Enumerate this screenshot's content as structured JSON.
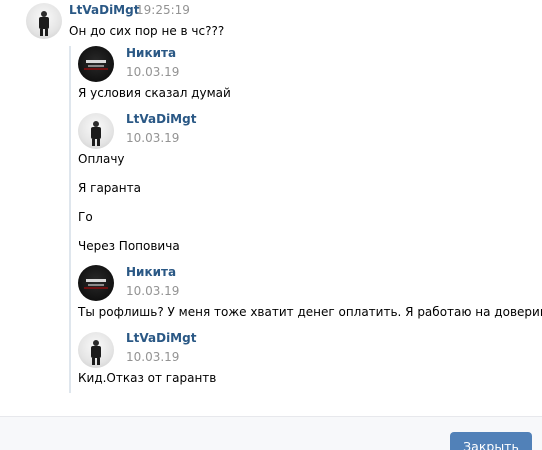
{
  "main_message": {
    "author": "LtVaDiMgt",
    "time": "19:25:19",
    "text": "Он до сих пор не в чс???"
  },
  "forwarded": [
    {
      "author": "Никита",
      "date": "10.03.19",
      "lines": [
        "Я условия сказал думай"
      ]
    },
    {
      "author": "LtVaDiMgt",
      "date": "10.03.19",
      "lines": [
        "Оплачу",
        "Я гаранта",
        "Го",
        "Через Поповича"
      ]
    },
    {
      "author": "Никита",
      "date": "10.03.19",
      "lines": [
        "Ты рофлишь? У меня тоже хватит денег оплатить. Я работаю на доверии."
      ]
    },
    {
      "author": "LtVaDiMgt",
      "date": "10.03.19",
      "lines": [
        "Кид.Отказ от гарантв"
      ]
    }
  ],
  "footer": {
    "close_label": "Закрыть"
  },
  "icons": {
    "avatar_light": "user-avatar-icon",
    "avatar_dark": "user-avatar-icon"
  },
  "colors": {
    "author_link": "#2a5885",
    "button": "#5181b8",
    "muted": "#939393"
  }
}
